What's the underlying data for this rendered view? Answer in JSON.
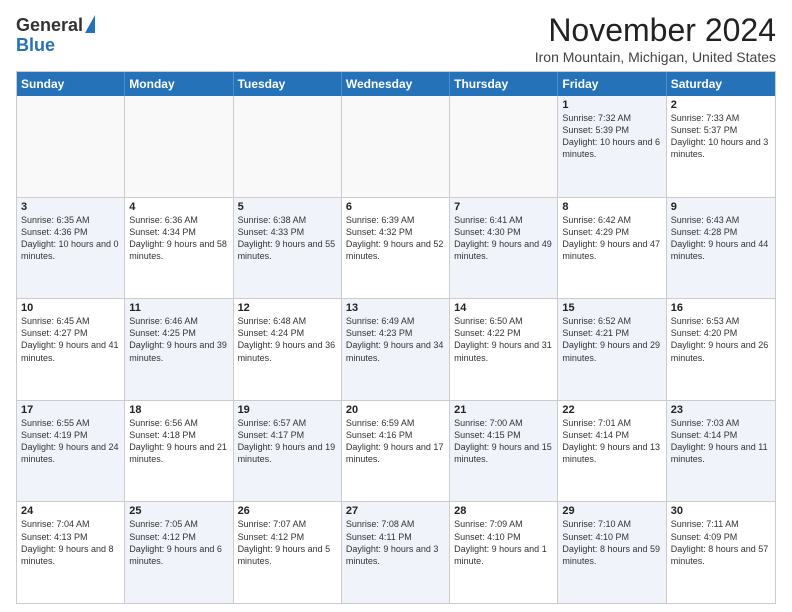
{
  "logo": {
    "general": "General",
    "blue": "Blue"
  },
  "title": "November 2024",
  "location": "Iron Mountain, Michigan, United States",
  "header_days": [
    "Sunday",
    "Monday",
    "Tuesday",
    "Wednesday",
    "Thursday",
    "Friday",
    "Saturday"
  ],
  "rows": [
    [
      {
        "day": "",
        "text": "",
        "empty": true
      },
      {
        "day": "",
        "text": "",
        "empty": true
      },
      {
        "day": "",
        "text": "",
        "empty": true
      },
      {
        "day": "",
        "text": "",
        "empty": true
      },
      {
        "day": "",
        "text": "",
        "empty": true
      },
      {
        "day": "1",
        "text": "Sunrise: 7:32 AM\nSunset: 5:39 PM\nDaylight: 10 hours and 6 minutes.",
        "empty": false,
        "alt": true
      },
      {
        "day": "2",
        "text": "Sunrise: 7:33 AM\nSunset: 5:37 PM\nDaylight: 10 hours and 3 minutes.",
        "empty": false,
        "alt": false
      }
    ],
    [
      {
        "day": "3",
        "text": "Sunrise: 6:35 AM\nSunset: 4:36 PM\nDaylight: 10 hours and 0 minutes.",
        "empty": false,
        "alt": true
      },
      {
        "day": "4",
        "text": "Sunrise: 6:36 AM\nSunset: 4:34 PM\nDaylight: 9 hours and 58 minutes.",
        "empty": false,
        "alt": false
      },
      {
        "day": "5",
        "text": "Sunrise: 6:38 AM\nSunset: 4:33 PM\nDaylight: 9 hours and 55 minutes.",
        "empty": false,
        "alt": true
      },
      {
        "day": "6",
        "text": "Sunrise: 6:39 AM\nSunset: 4:32 PM\nDaylight: 9 hours and 52 minutes.",
        "empty": false,
        "alt": false
      },
      {
        "day": "7",
        "text": "Sunrise: 6:41 AM\nSunset: 4:30 PM\nDaylight: 9 hours and 49 minutes.",
        "empty": false,
        "alt": true
      },
      {
        "day": "8",
        "text": "Sunrise: 6:42 AM\nSunset: 4:29 PM\nDaylight: 9 hours and 47 minutes.",
        "empty": false,
        "alt": false
      },
      {
        "day": "9",
        "text": "Sunrise: 6:43 AM\nSunset: 4:28 PM\nDaylight: 9 hours and 44 minutes.",
        "empty": false,
        "alt": true
      }
    ],
    [
      {
        "day": "10",
        "text": "Sunrise: 6:45 AM\nSunset: 4:27 PM\nDaylight: 9 hours and 41 minutes.",
        "empty": false,
        "alt": false
      },
      {
        "day": "11",
        "text": "Sunrise: 6:46 AM\nSunset: 4:25 PM\nDaylight: 9 hours and 39 minutes.",
        "empty": false,
        "alt": true
      },
      {
        "day": "12",
        "text": "Sunrise: 6:48 AM\nSunset: 4:24 PM\nDaylight: 9 hours and 36 minutes.",
        "empty": false,
        "alt": false
      },
      {
        "day": "13",
        "text": "Sunrise: 6:49 AM\nSunset: 4:23 PM\nDaylight: 9 hours and 34 minutes.",
        "empty": false,
        "alt": true
      },
      {
        "day": "14",
        "text": "Sunrise: 6:50 AM\nSunset: 4:22 PM\nDaylight: 9 hours and 31 minutes.",
        "empty": false,
        "alt": false
      },
      {
        "day": "15",
        "text": "Sunrise: 6:52 AM\nSunset: 4:21 PM\nDaylight: 9 hours and 29 minutes.",
        "empty": false,
        "alt": true
      },
      {
        "day": "16",
        "text": "Sunrise: 6:53 AM\nSunset: 4:20 PM\nDaylight: 9 hours and 26 minutes.",
        "empty": false,
        "alt": false
      }
    ],
    [
      {
        "day": "17",
        "text": "Sunrise: 6:55 AM\nSunset: 4:19 PM\nDaylight: 9 hours and 24 minutes.",
        "empty": false,
        "alt": true
      },
      {
        "day": "18",
        "text": "Sunrise: 6:56 AM\nSunset: 4:18 PM\nDaylight: 9 hours and 21 minutes.",
        "empty": false,
        "alt": false
      },
      {
        "day": "19",
        "text": "Sunrise: 6:57 AM\nSunset: 4:17 PM\nDaylight: 9 hours and 19 minutes.",
        "empty": false,
        "alt": true
      },
      {
        "day": "20",
        "text": "Sunrise: 6:59 AM\nSunset: 4:16 PM\nDaylight: 9 hours and 17 minutes.",
        "empty": false,
        "alt": false
      },
      {
        "day": "21",
        "text": "Sunrise: 7:00 AM\nSunset: 4:15 PM\nDaylight: 9 hours and 15 minutes.",
        "empty": false,
        "alt": true
      },
      {
        "day": "22",
        "text": "Sunrise: 7:01 AM\nSunset: 4:14 PM\nDaylight: 9 hours and 13 minutes.",
        "empty": false,
        "alt": false
      },
      {
        "day": "23",
        "text": "Sunrise: 7:03 AM\nSunset: 4:14 PM\nDaylight: 9 hours and 11 minutes.",
        "empty": false,
        "alt": true
      }
    ],
    [
      {
        "day": "24",
        "text": "Sunrise: 7:04 AM\nSunset: 4:13 PM\nDaylight: 9 hours and 8 minutes.",
        "empty": false,
        "alt": false
      },
      {
        "day": "25",
        "text": "Sunrise: 7:05 AM\nSunset: 4:12 PM\nDaylight: 9 hours and 6 minutes.",
        "empty": false,
        "alt": true
      },
      {
        "day": "26",
        "text": "Sunrise: 7:07 AM\nSunset: 4:12 PM\nDaylight: 9 hours and 5 minutes.",
        "empty": false,
        "alt": false
      },
      {
        "day": "27",
        "text": "Sunrise: 7:08 AM\nSunset: 4:11 PM\nDaylight: 9 hours and 3 minutes.",
        "empty": false,
        "alt": true
      },
      {
        "day": "28",
        "text": "Sunrise: 7:09 AM\nSunset: 4:10 PM\nDaylight: 9 hours and 1 minute.",
        "empty": false,
        "alt": false
      },
      {
        "day": "29",
        "text": "Sunrise: 7:10 AM\nSunset: 4:10 PM\nDaylight: 8 hours and 59 minutes.",
        "empty": false,
        "alt": true
      },
      {
        "day": "30",
        "text": "Sunrise: 7:11 AM\nSunset: 4:09 PM\nDaylight: 8 hours and 57 minutes.",
        "empty": false,
        "alt": false
      }
    ]
  ]
}
